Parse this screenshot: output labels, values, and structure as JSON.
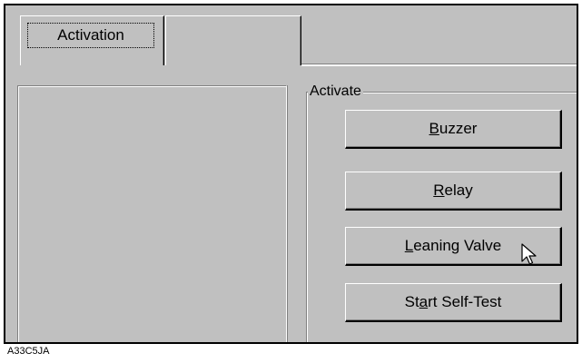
{
  "tabs": [
    {
      "label": "Activation",
      "active": true
    },
    {
      "label": ""
    }
  ],
  "activate_group": {
    "title": "Activate",
    "buttons": [
      {
        "label": "Buzzer",
        "mnemonic": "B",
        "rest": "uzzer"
      },
      {
        "label": "Relay",
        "mnemonic": "R",
        "rest": "elay"
      },
      {
        "label": "Leaning Valve",
        "mnemonic": "L",
        "rest": "eaning Valve"
      },
      {
        "label": "Start Self-Test",
        "pre": "St",
        "mnemonic": "a",
        "rest": "rt Self-Test"
      }
    ]
  },
  "cursor_icon": "arrow-pointer",
  "figure_code": "A33C5JA",
  "colors": {
    "face": "#c0c0c0",
    "shadow": "#808080",
    "highlight": "#ffffff",
    "dark": "#000000"
  }
}
